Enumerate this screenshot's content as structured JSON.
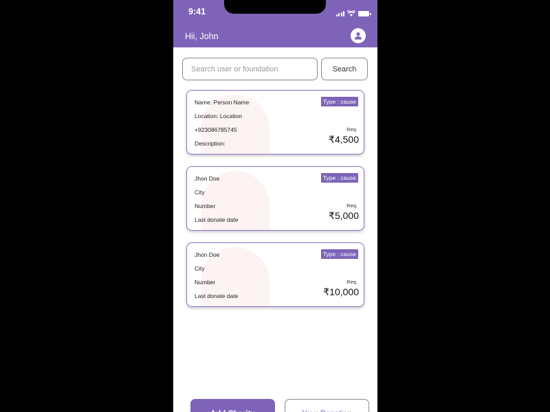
{
  "status_bar": {
    "time": "9:41"
  },
  "header": {
    "greeting": "Hii, John"
  },
  "search": {
    "placeholder": "Search user or foundation",
    "button_label": "Search"
  },
  "cards": [
    {
      "line1": "Name: Person Name",
      "line2": "Location: Location",
      "line3": "+923086785745",
      "line4": "Description:",
      "badge": "Type : cause",
      "req_label": "Req.",
      "amount": "₹4,500"
    },
    {
      "line1": "Jhon Doe",
      "line2": "City",
      "line3": "Number",
      "line4": "Last donate date",
      "badge": "Type : cause",
      "req_label": "Req.",
      "amount": "₹5,000"
    },
    {
      "line1": "Jhon Doe",
      "line2": "City",
      "line3": "Number",
      "line4": "Last donate date",
      "badge": "Type : cause",
      "req_label": "Req.",
      "amount": "₹10,000"
    }
  ],
  "bottom_actions": {
    "add_charity": "Add Charity",
    "your_donation": "Your Donation"
  },
  "colors": {
    "accent": "#7e63b8",
    "background": "#ffffff"
  },
  "icons": {
    "avatar": "user-icon",
    "signal": "signal-icon",
    "wifi": "wifi-icon",
    "battery": "battery-icon"
  }
}
